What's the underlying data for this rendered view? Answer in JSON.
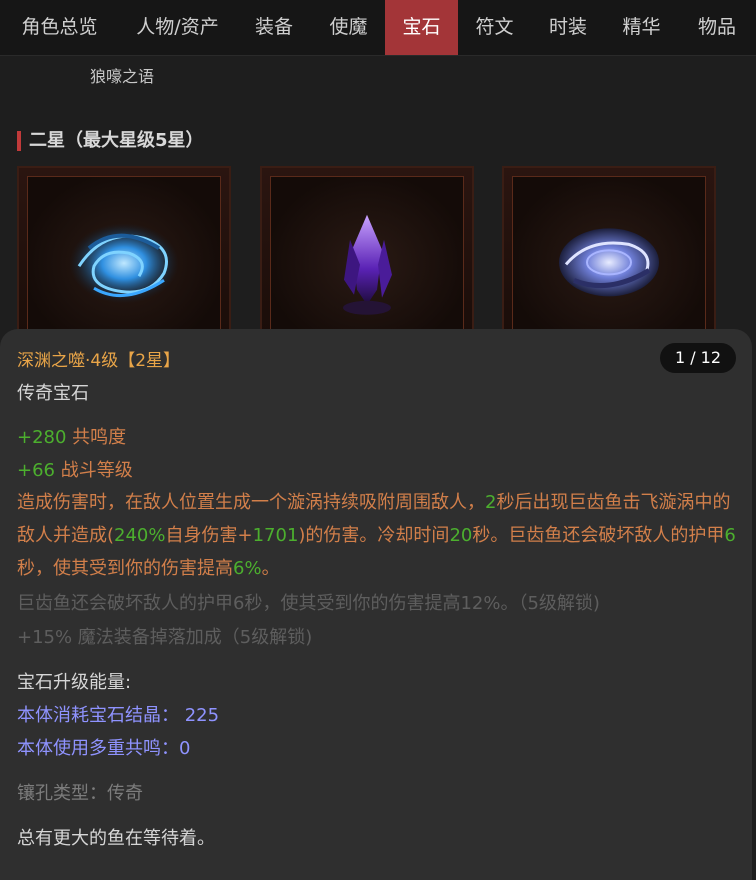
{
  "tabs": [
    {
      "label": "角色总览",
      "active": false
    },
    {
      "label": "人物/资产",
      "active": false
    },
    {
      "label": "装备",
      "active": false
    },
    {
      "label": "使魔",
      "active": false
    },
    {
      "label": "宝石",
      "active": true
    },
    {
      "label": "符文",
      "active": false
    },
    {
      "label": "时装",
      "active": false
    },
    {
      "label": "精华",
      "active": false
    },
    {
      "label": "物品",
      "active": false
    }
  ],
  "subnav": {
    "label": "狼嚎之语"
  },
  "section": {
    "title": "二星（最大星级5星）"
  },
  "gems": [
    {
      "art": "blue-vortex-gem-icon"
    },
    {
      "art": "purple-crystal-gem-icon"
    },
    {
      "art": "blue-orb-gem-icon"
    }
  ],
  "tooltip": {
    "name": "深渊之噬·4级【2星】",
    "type": "传奇宝石",
    "pager": "1 / 12",
    "stats": [
      {
        "value": "+280",
        "label": " 共鸣度"
      },
      {
        "value": "+66",
        "label": " 战斗等级"
      }
    ],
    "effect": {
      "p1": "造成伤害时，在敌人位置生成一个漩涡持续吸附周围敌人，",
      "v1": "2",
      "p2": "秒后出现巨齿鱼击飞漩涡中的敌人并造成(",
      "v2": "240%",
      "p3": "自身伤害+",
      "v3": "1701",
      "p4": ")的伤害。冷却时间",
      "v4": "20",
      "p5": "秒。巨齿鱼还会破坏敌人的护甲",
      "v5": "6",
      "p6": "秒，使其受到你的伤害提高",
      "v6": "6%",
      "p7": "。"
    },
    "locked": [
      "巨齿鱼还会破坏敌人的护甲6秒，使其受到你的伤害提高12%。（5级解锁)",
      "+15% 魔法装备掉落加成（5级解锁)"
    ],
    "upgrade_title": "宝石升级能量:",
    "upgrade": [
      "本体消耗宝石结晶： 225",
      "本体使用多重共鸣：0"
    ],
    "socket": "镶孔类型：传奇",
    "flavor": "总有更大的鱼在等待着。"
  }
}
